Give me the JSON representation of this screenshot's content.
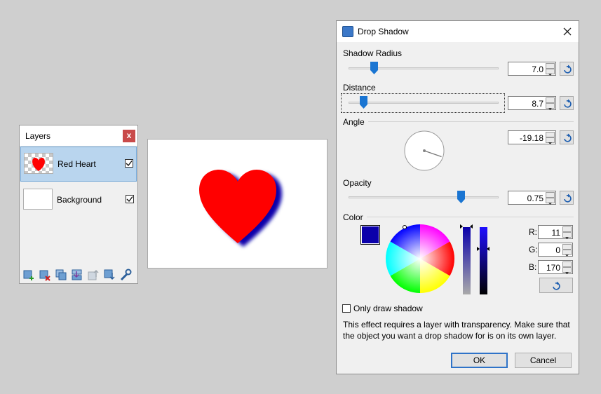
{
  "layers_panel": {
    "title": "Layers",
    "close_label": "x",
    "layers": [
      {
        "name": "Red Heart",
        "visible": true,
        "selected": true
      },
      {
        "name": "Background",
        "visible": true,
        "selected": false
      }
    ],
    "toolbar_icons": [
      "add-layer-icon",
      "delete-layer-icon",
      "duplicate-layer-icon",
      "merge-layer-down-icon",
      "move-layer-up-icon",
      "move-layer-down-icon",
      "layer-properties-icon"
    ]
  },
  "canvas": {
    "shape": "heart",
    "shape_color": "#ff0000",
    "shadow_color": "#0b00aa"
  },
  "dialog": {
    "title": "Drop Shadow",
    "shadow_radius": {
      "label": "Shadow Radius",
      "value": "7.0",
      "fraction": 0.17
    },
    "distance": {
      "label": "Distance",
      "value": "8.7",
      "fraction": 0.1
    },
    "angle": {
      "label": "Angle",
      "value": "-19.18",
      "degrees": -19.18
    },
    "opacity": {
      "label": "Opacity",
      "value": "0.75",
      "fraction": 0.75
    },
    "color": {
      "label": "Color",
      "hex": "#0b00aa",
      "r_label": "R:",
      "r_value": "11",
      "g_label": "G:",
      "g_value": "0",
      "b_label": "B:",
      "b_value": "170"
    },
    "only_draw_shadow": {
      "label": "Only draw shadow",
      "checked": false
    },
    "info_text": "This effect requires a layer with transparency. Make sure that the object you want a drop shadow for is on its own layer.",
    "ok_label": "OK",
    "cancel_label": "Cancel"
  }
}
